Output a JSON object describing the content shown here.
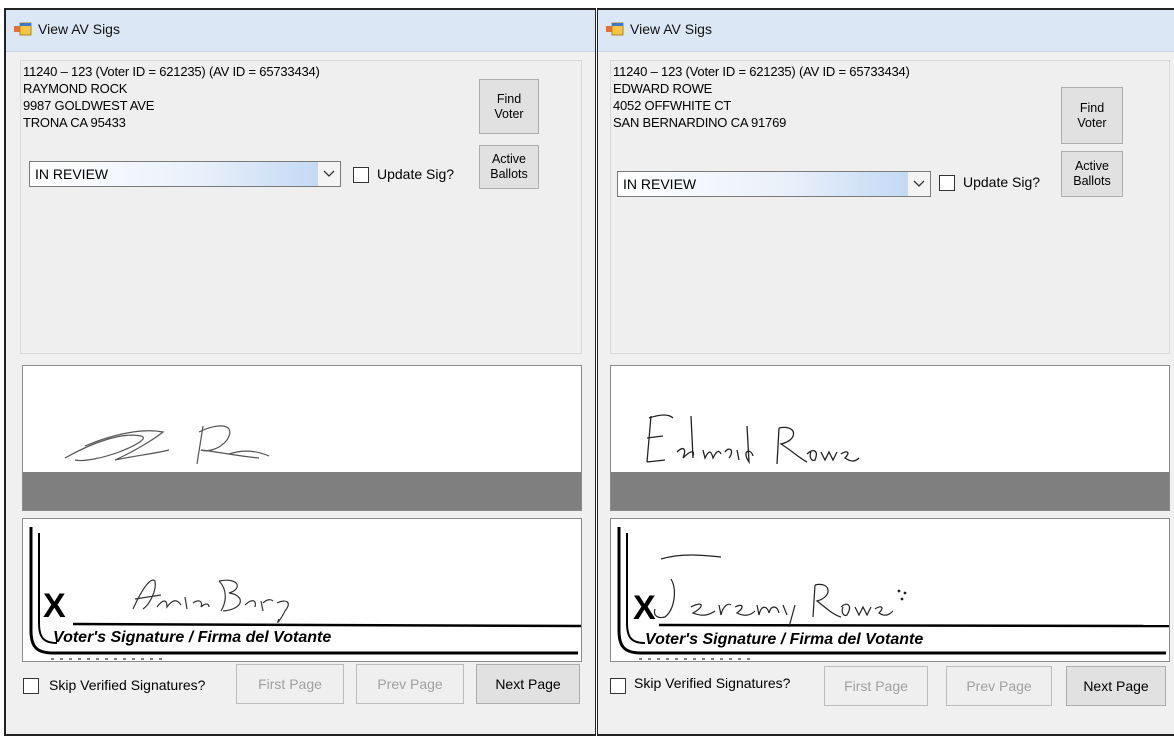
{
  "left_window": {
    "title": "View AV Sigs",
    "id_line": "11240 – 123 (Voter ID = 621235) (AV ID = 65733434)",
    "name": "RAYMOND ROCK",
    "address1": "9987 GOLDWEST AVE",
    "address2": "TRONA CA 95433",
    "find_voter_label": "Find\nVoter",
    "status_value": "IN REVIEW",
    "update_sig_label": "Update Sig?",
    "active_ballots_label": "Active\nBallots",
    "ballot_signature_caption": "Voter's Signature / Firma del Votante",
    "skip_verified_label": "Skip Verified Signatures?",
    "first_page_label": "First Page",
    "prev_page_label": "Prev Page",
    "next_page_label": "Next Page"
  },
  "right_window": {
    "title": "View AV Sigs",
    "id_line": "11240 – 123 (Voter ID = 621235) (AV ID = 65733434)",
    "name": "EDWARD ROWE",
    "address1": "4052 OFFWHITE CT",
    "address2": "SAN BERNARDINO CA 91769",
    "find_voter_label": "Find\nVoter",
    "status_value": "IN REVIEW",
    "update_sig_label": "Update Sig?",
    "active_ballots_label": "Active\nBallots",
    "ballot_signature_caption": "Voter's Signature / Firma del Votante",
    "skip_verified_label": "Skip Verified Signatures?",
    "first_page_label": "First Page",
    "prev_page_label": "Prev Page",
    "next_page_label": "Next Page"
  },
  "signature_x_mark": "X",
  "icons": {
    "window_icon": "app-window-icon",
    "dropdown": "chevron-down-icon"
  },
  "colors": {
    "titlebar": "#dbe7f5",
    "window_bg": "#f0f0f0",
    "signature_band": "#7f7f7f"
  }
}
